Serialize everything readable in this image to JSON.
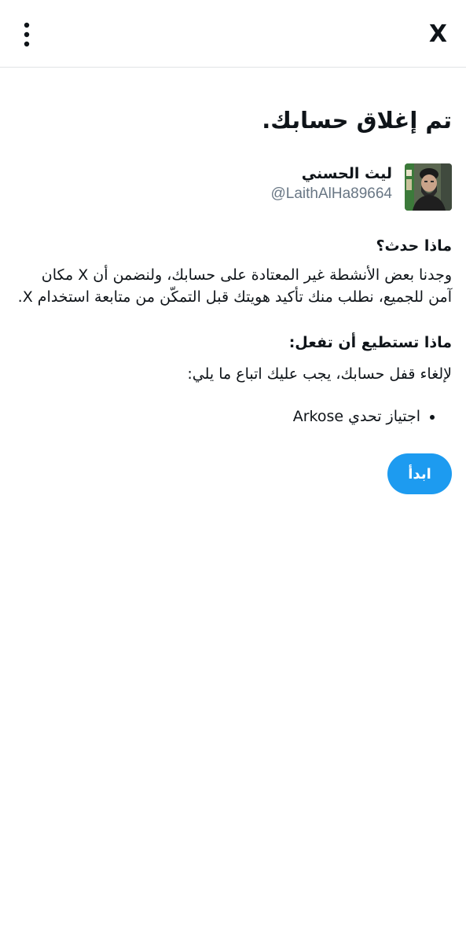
{
  "header": {
    "menu_icon": "more-vertical-icon",
    "logo_text": "X"
  },
  "page": {
    "title": "تم إغلاق حسابك."
  },
  "profile": {
    "display_name": "ليث الحسني",
    "handle": "@LaithAlHa89664",
    "avatar_icon": "profile-photo"
  },
  "what_happened": {
    "heading": "ماذا حدث؟",
    "body": "وجدنا بعض الأنشطة غير المعتادة على حسابك، ولنضمن أن X مكان آمن للجميع، نطلب منك تأكيد هويتك قبل التمكّن من متابعة استخدام X."
  },
  "what_to_do": {
    "heading": "ماذا تستطيع أن تفعل:",
    "intro": "لإلغاء قفل حسابك، يجب عليك اتباع ما يلي:",
    "steps": [
      "اجتياز تحدي Arkose"
    ]
  },
  "actions": {
    "start_label": "ابدأ"
  },
  "colors": {
    "accent": "#1d9bf0",
    "text": "#0f1419",
    "muted": "#687684",
    "divider": "#e1e4e6"
  }
}
